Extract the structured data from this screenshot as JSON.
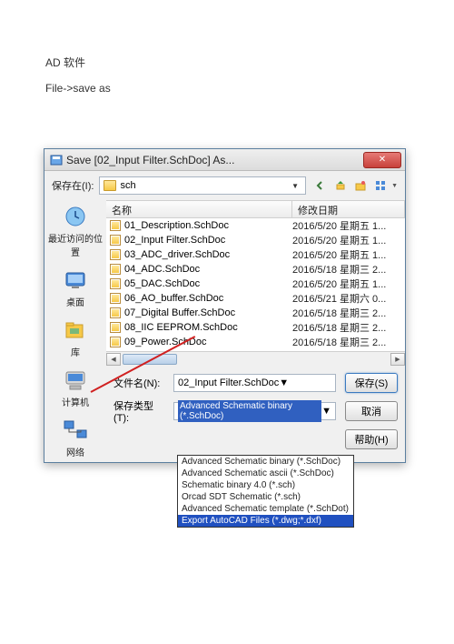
{
  "page": {
    "heading": "AD 软件",
    "sub": "File->save as"
  },
  "dialog": {
    "title": "Save [02_Input Filter.SchDoc] As...",
    "save_in_label": "保存在(I):",
    "location_value": "sch",
    "columns": {
      "name": "名称",
      "date": "修改日期"
    },
    "files": [
      {
        "name": "01_Description.SchDoc",
        "date": "2016/5/20 星期五 1..."
      },
      {
        "name": "02_Input Filter.SchDoc",
        "date": "2016/5/20 星期五 1..."
      },
      {
        "name": "03_ADC_driver.SchDoc",
        "date": "2016/5/20 星期五 1..."
      },
      {
        "name": "04_ADC.SchDoc",
        "date": "2016/5/18 星期三 2..."
      },
      {
        "name": "05_DAC.SchDoc",
        "date": "2016/5/20 星期五 1..."
      },
      {
        "name": "06_AO_buffer.SchDoc",
        "date": "2016/5/21 星期六 0..."
      },
      {
        "name": "07_Digital Buffer.SchDoc",
        "date": "2016/5/18 星期三 2..."
      },
      {
        "name": "08_IIC EEPROM.SchDoc",
        "date": "2016/5/18 星期三 2..."
      },
      {
        "name": "09_Power.SchDoc",
        "date": "2016/5/18 星期三 2..."
      }
    ],
    "filename_label": "文件名(N):",
    "filename_value": "02_Input Filter.SchDoc",
    "savetype_label": "保存类型(T):",
    "savetype_value": "Advanced Schematic binary (*.SchDoc)",
    "savetype_options": [
      "Advanced Schematic binary (*.SchDoc)",
      "Advanced Schematic ascii (*.SchDoc)",
      "Schematic binary 4.0 (*.sch)",
      "Orcad SDT Schematic (*.sch)",
      "Advanced Schematic template (*.SchDot)",
      "Export AutoCAD Files (*.dwg;*.dxf)"
    ],
    "buttons": {
      "save": "保存(S)",
      "cancel": "取消",
      "help": "帮助(H)"
    },
    "sidebar": [
      "最近访问的位置",
      "桌面",
      "库",
      "计算机",
      "网络"
    ]
  }
}
